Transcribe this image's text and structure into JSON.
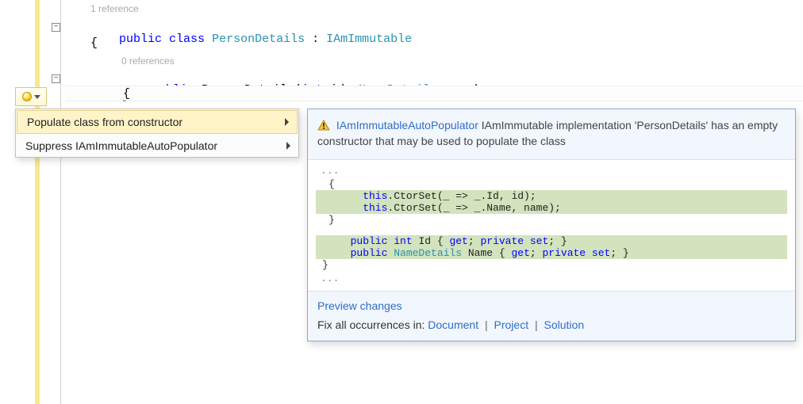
{
  "code": {
    "ref1": "1 reference",
    "line1_public": "public",
    "line1_class": "class",
    "line1_type": "PersonDetails",
    "line1_colon": " : ",
    "line1_iface": "IAmImmutable",
    "open_brace": "{",
    "ref2": "0 references",
    "ctor_public": "public",
    "ctor_name": " PersonDetails(",
    "ctor_int": "int",
    "ctor_id": " id, ",
    "ctor_type": "NameDetails",
    "ctor_rest": " name)",
    "ctor_open": "{"
  },
  "menu": {
    "item1": "Populate class from constructor",
    "item2": "Suppress IAmImmutableAutoPopulator"
  },
  "preview": {
    "analyzer": "IAmImmutableAutoPopulator",
    "message": " IAmImmutable implementation 'PersonDetails' has an empty constructor that may be used to populate the class",
    "dots": "...",
    "brace_open": "  {",
    "ctorset1_a": "    this",
    "ctorset1_b": ".CtorSet(_ => _.Id, id);",
    "ctorset2_a": "    this",
    "ctorset2_b": ".CtorSet(_ => _.Name, name);",
    "brace_close": "  }",
    "prop1_pub": "  public",
    "prop1_int": " int",
    "prop1_name": " Id { ",
    "prop1_get": "get",
    "prop1_mid": "; ",
    "prop1_priv": "private",
    "prop1_set": " set",
    "prop1_end": "; }",
    "prop2_pub": "  public",
    "prop2_type": " NameDetails",
    "prop2_name": " Name { ",
    "prop2_get": "get",
    "prop2_mid": "; ",
    "prop2_priv": "private",
    "prop2_set": " set",
    "prop2_end": "; }",
    "close_brace": "}"
  },
  "footer": {
    "preview_changes": "Preview changes",
    "fix_all": "Fix all occurrences in: ",
    "document": "Document",
    "project": "Project",
    "solution": "Solution"
  }
}
